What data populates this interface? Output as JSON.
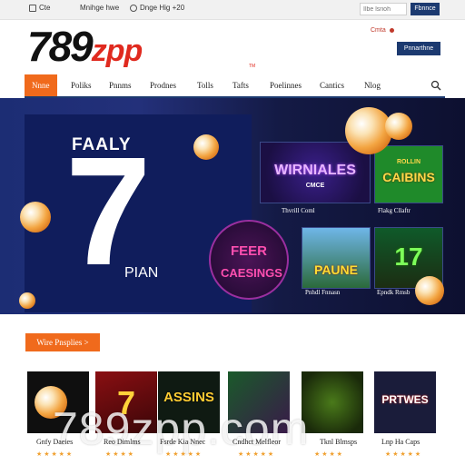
{
  "topbar": {
    "item1": "Cte",
    "item2": "Mnihge hwe",
    "item3": "Dnge Hig +20",
    "search_placeholder": "Ilbe lsrioh",
    "button": "Fbnnce"
  },
  "header": {
    "logo_main": "789",
    "logo_accent": "zpp",
    "logo_tm": "TM",
    "link": "Cmta",
    "button": "Pnnarthne"
  },
  "nav": {
    "items": [
      "Nnne",
      "Poliks",
      "Pnnms",
      "Prodnes",
      "Tolls",
      "Tafts",
      "Poelinnes",
      "Cantics",
      "Nlog"
    ]
  },
  "hero": {
    "title": "FAALY",
    "big_number": "7",
    "subtitle": "PIAN",
    "promo_line1": "FEER",
    "promo_line2": "CAESINGS",
    "tiles": [
      {
        "text": "WIRNIALES",
        "sub": "CMCE",
        "caption": "Thvrill Coml"
      },
      {
        "text": "CAIBINS",
        "sub": "ROLLIN",
        "caption": "Flakg Cllaftr"
      },
      {
        "text": "PAUNE",
        "sub": "",
        "caption": "Pnhdl Fnnasn"
      },
      {
        "text": "17",
        "sub": "",
        "caption": "Epndk Rmsb"
      }
    ]
  },
  "promos": {
    "button": "Wire Pnsplies >"
  },
  "cards": [
    {
      "text": "",
      "label": "Gnfy Daeies",
      "stars": "★ ★ ★ ★ ★"
    },
    {
      "text": "7",
      "label": "Reo Dimlms",
      "stars": "★ ★ ★ ★"
    },
    {
      "text": "ASSINS",
      "label": "Fsrde Kia Nnec",
      "stars": "★ ★ ★ ★ ★"
    },
    {
      "text": "",
      "label": "Cndhct Melfleor",
      "stars": "★ ★ ★ ★ ★"
    },
    {
      "text": "",
      "label": "Tknl Blmsps",
      "stars": "★ ★ ★ ★"
    },
    {
      "text": "PRTWES",
      "label": "Lnp Ha Caps",
      "stars": "★ ★ ★ ★ ★"
    }
  ],
  "watermark": "789zpp.com",
  "colors": {
    "accent": "#f06a1c",
    "brand_navy": "#1c3a70",
    "logo_red": "#e02a1f",
    "hero_bg": "#1c2d74"
  }
}
